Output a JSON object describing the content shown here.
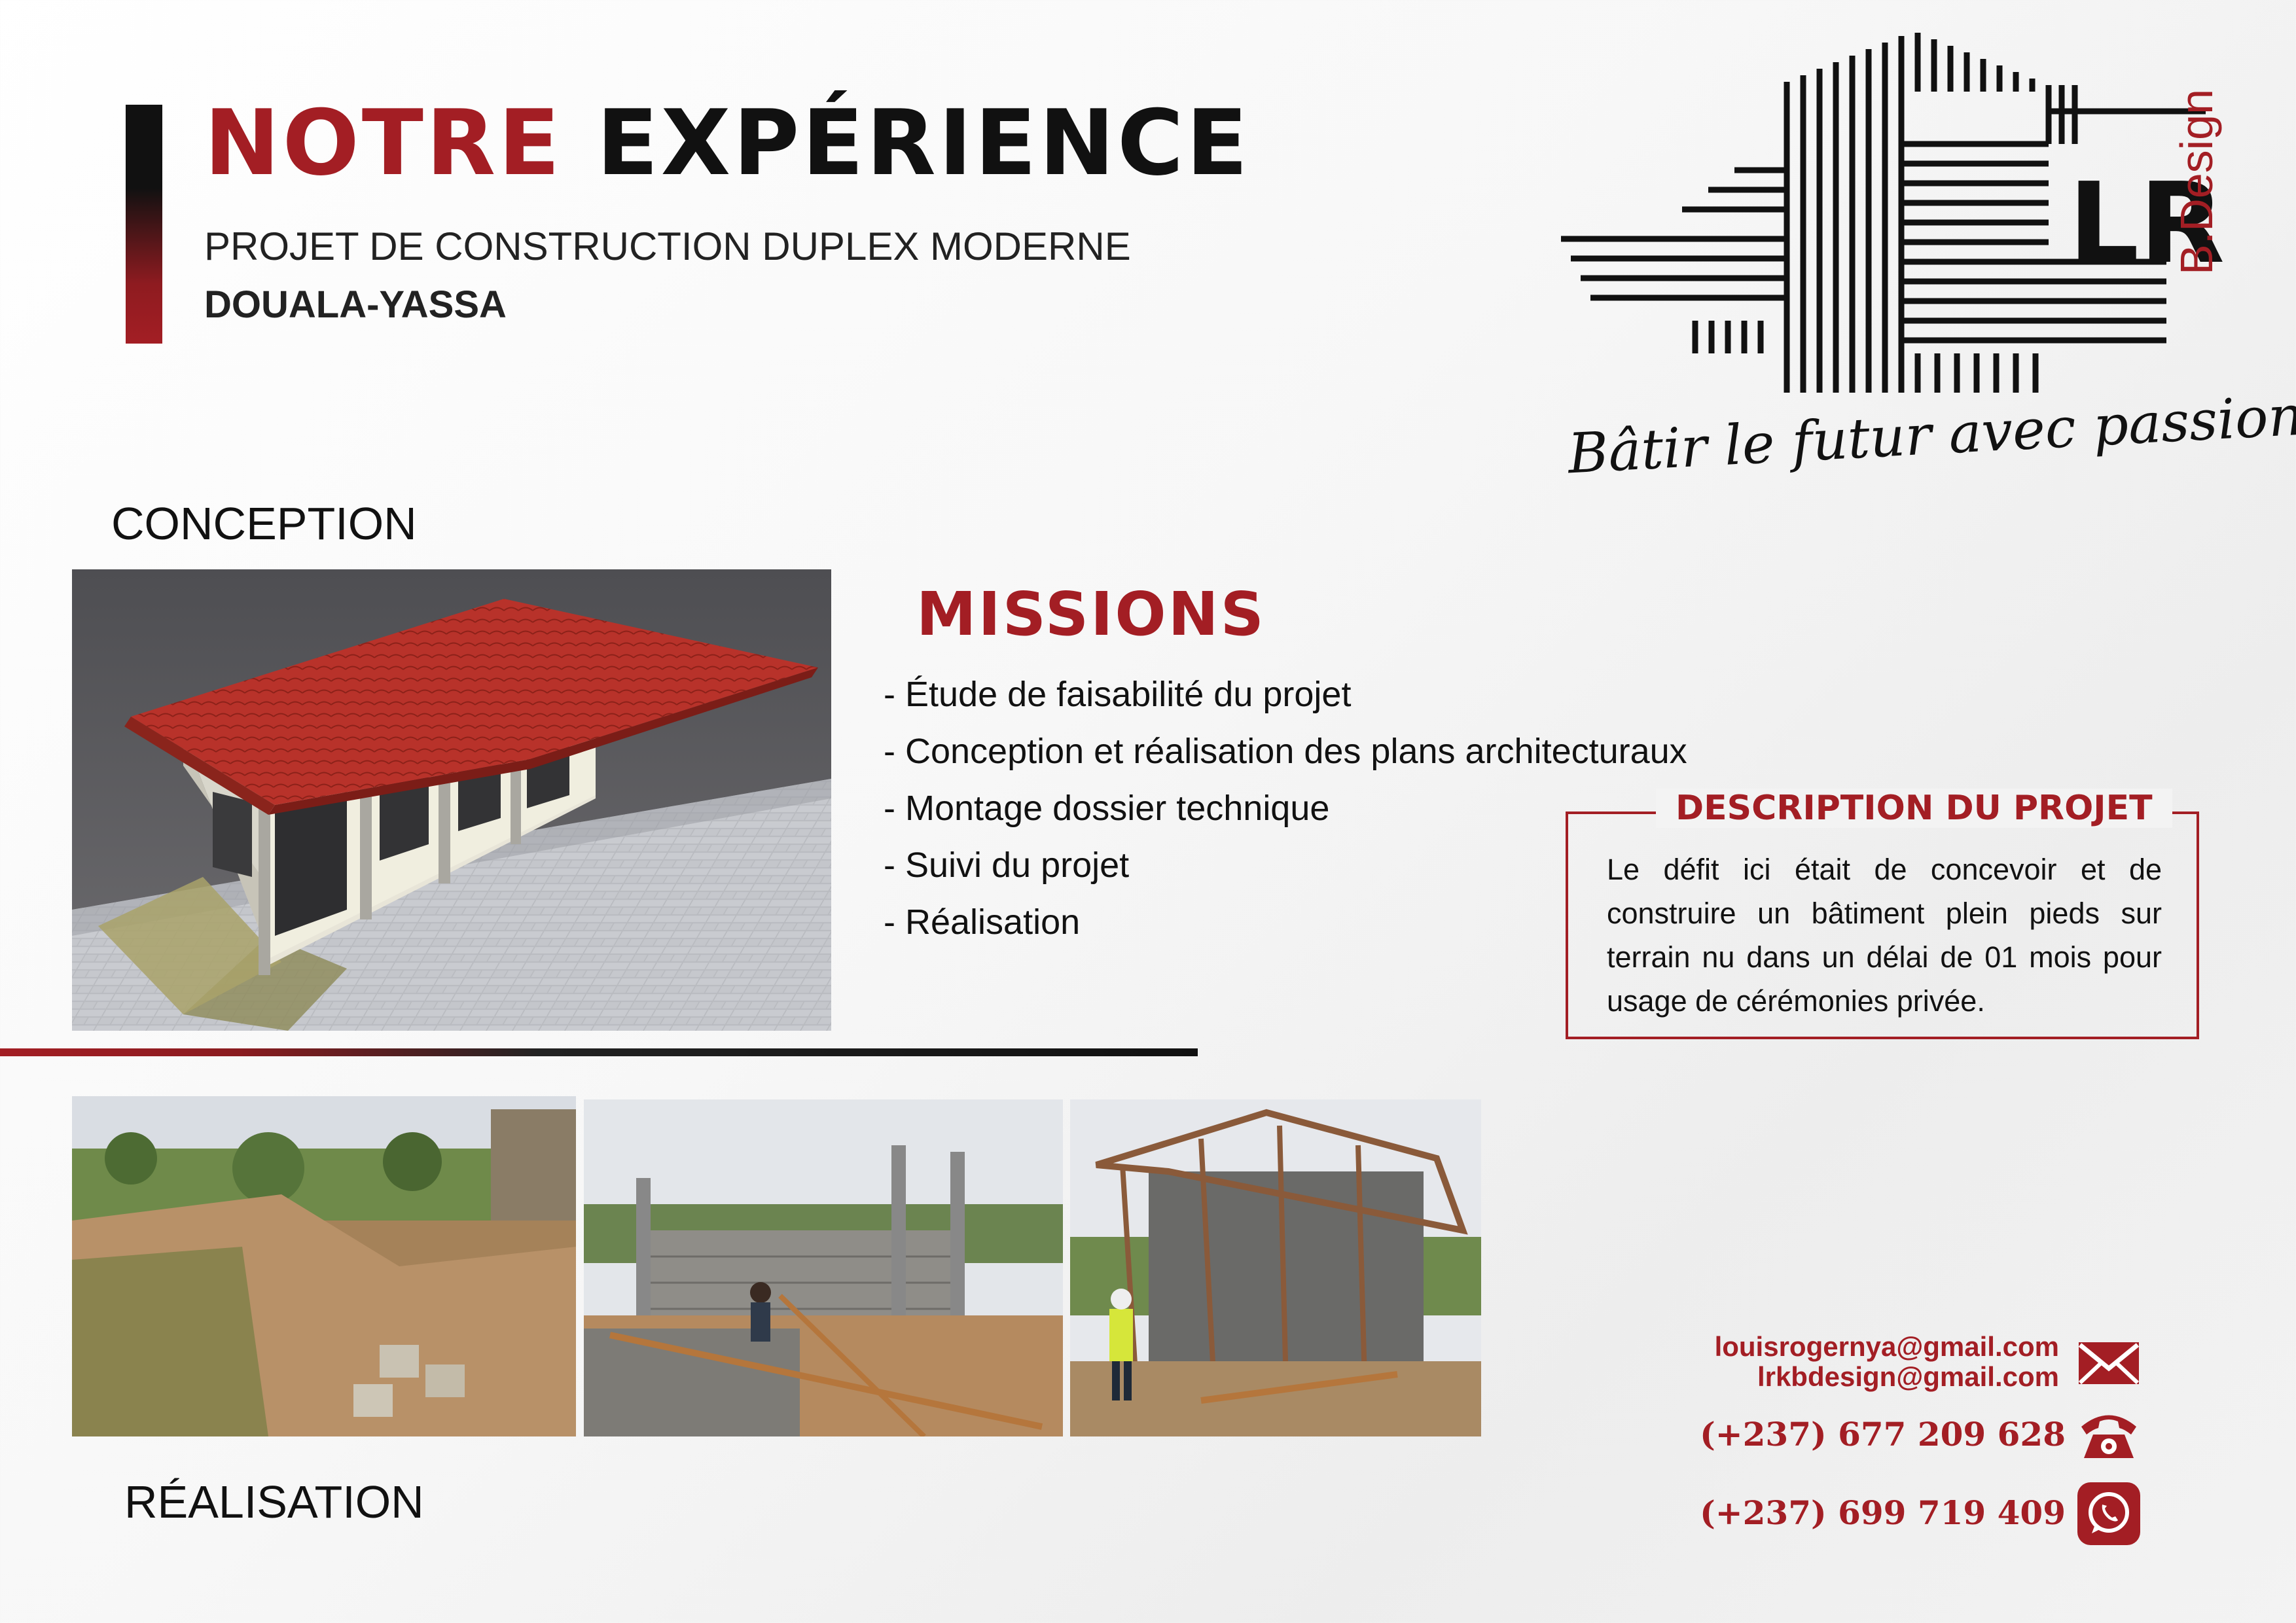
{
  "header": {
    "title_part1": "NOTRE",
    "title_part2": "EXPÉRIENCE",
    "subtitle": "PROJET DE CONSTRUCTION DUPLEX MODERNE",
    "location": "DOUALA-YASSA"
  },
  "logo": {
    "letters": "LRK",
    "brand_suffix": "B.Design",
    "tagline": "Bâtir le futur avec passion"
  },
  "sections": {
    "conception": "CONCEPTION",
    "realisation": "RÉALISATION"
  },
  "missions": {
    "title": "MISSIONS",
    "items": [
      "- Étude de faisabilité du projet",
      "- Conception et réalisation des plans architecturaux",
      "- Montage dossier technique",
      "- Suivi du projet",
      "- Réalisation"
    ]
  },
  "description": {
    "title": "DESCRIPTION DU PROJET",
    "text": "Le défit ici était de concevoir et de construire un bâtiment plein pieds sur terrain nu dans un délai de 01 mois pour usage de cérémonies privée."
  },
  "contacts": {
    "email_1": "louisrogernya@gmail.com",
    "email_2": "lrkbdesign@gmail.com",
    "phone_1": "(+237)  677 209 628",
    "phone_2": "(+237) 699 719 409"
  },
  "colors": {
    "accent": "#a31e24",
    "dark": "#111111",
    "background": "#f3f3f3"
  },
  "icons": [
    "mail-icon",
    "phone-icon",
    "whatsapp-icon"
  ]
}
